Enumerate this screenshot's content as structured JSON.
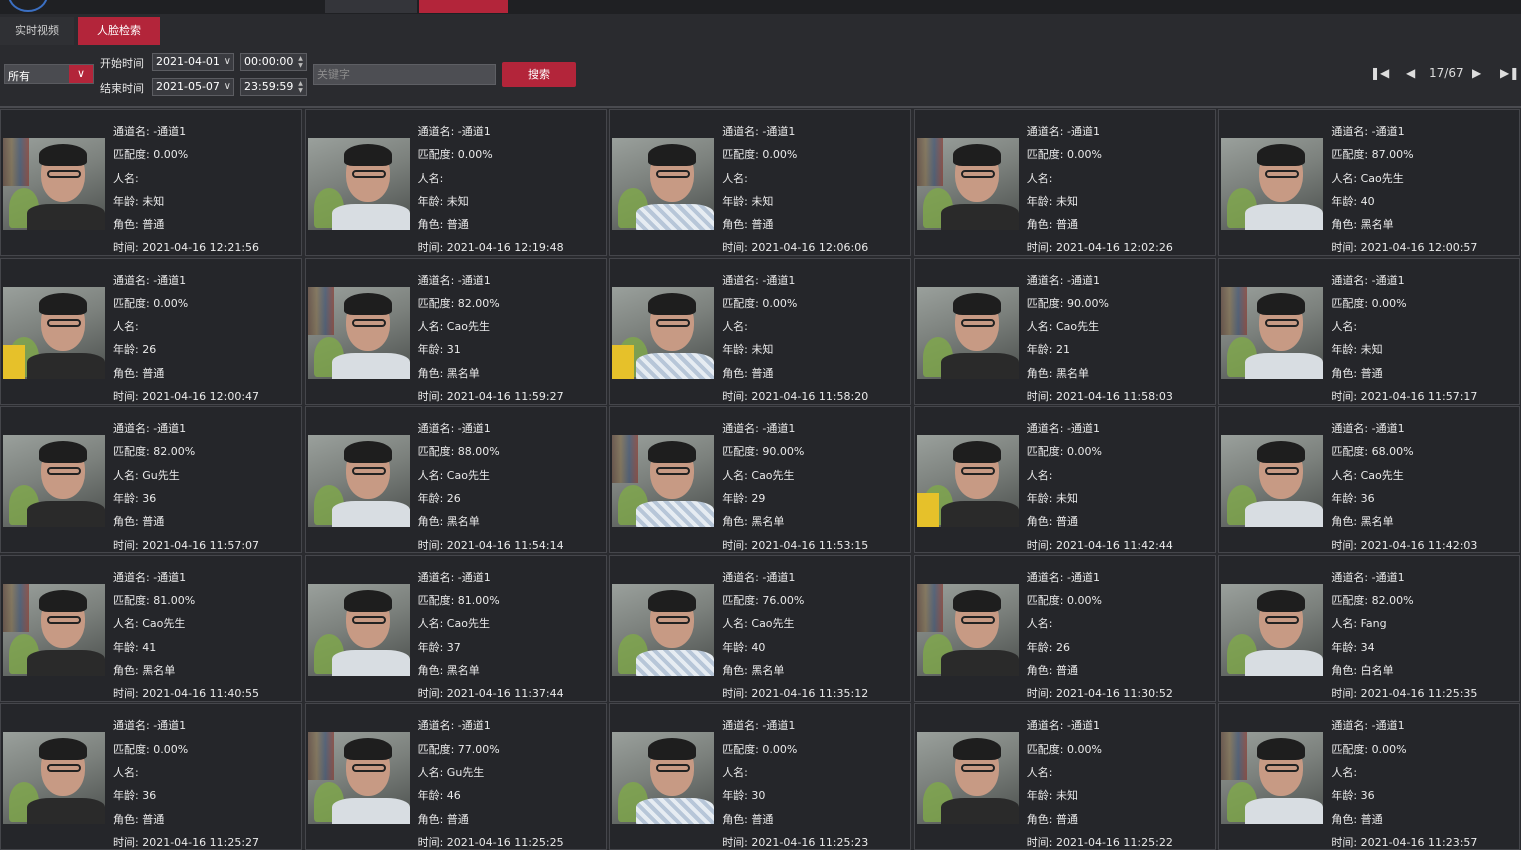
{
  "top_tabs": [
    "",
    ""
  ],
  "sub_tabs": [
    "实时视频",
    "人脸检索"
  ],
  "filter": {
    "select_value": "所有",
    "start_label": "开始时间",
    "end_label": "结束时间",
    "start_date": "2021-04-01",
    "start_time": "00:00:00",
    "end_date": "2021-05-07",
    "end_time": "23:59:59",
    "keyword_placeholder": "关键字",
    "search_label": "搜索"
  },
  "pager": {
    "page": "17/67"
  },
  "field_labels": {
    "channel": "通道名: ",
    "match": "匹配度: ",
    "name": "人名: ",
    "age": "年龄: ",
    "role": "角色: ",
    "time": "时间: "
  },
  "cards": [
    {
      "channel": "-通道1",
      "match": "0.00%",
      "name": "",
      "age": "未知",
      "role": "普通",
      "time": "2021-04-16 12:21:56"
    },
    {
      "channel": "-通道1",
      "match": "0.00%",
      "name": "",
      "age": "未知",
      "role": "普通",
      "time": "2021-04-16 12:19:48"
    },
    {
      "channel": "-通道1",
      "match": "0.00%",
      "name": "",
      "age": "未知",
      "role": "普通",
      "time": "2021-04-16 12:06:06"
    },
    {
      "channel": "-通道1",
      "match": "0.00%",
      "name": "",
      "age": "未知",
      "role": "普通",
      "time": "2021-04-16 12:02:26"
    },
    {
      "channel": "-通道1",
      "match": "87.00%",
      "name": "Cao先生",
      "age": "40",
      "role": "黑名单",
      "time": "2021-04-16 12:00:57"
    },
    {
      "channel": "-通道1",
      "match": "0.00%",
      "name": "",
      "age": "26",
      "role": "普通",
      "time": "2021-04-16 12:00:47"
    },
    {
      "channel": "-通道1",
      "match": "82.00%",
      "name": "Cao先生",
      "age": "31",
      "role": "黑名单",
      "time": "2021-04-16 11:59:27"
    },
    {
      "channel": "-通道1",
      "match": "0.00%",
      "name": "",
      "age": "未知",
      "role": "普通",
      "time": "2021-04-16 11:58:20"
    },
    {
      "channel": "-通道1",
      "match": "90.00%",
      "name": "Cao先生",
      "age": "21",
      "role": "黑名单",
      "time": "2021-04-16 11:58:03"
    },
    {
      "channel": "-通道1",
      "match": "0.00%",
      "name": "",
      "age": "未知",
      "role": "普通",
      "time": "2021-04-16 11:57:17"
    },
    {
      "channel": "-通道1",
      "match": "82.00%",
      "name": "Gu先生",
      "age": "36",
      "role": "普通",
      "time": "2021-04-16 11:57:07"
    },
    {
      "channel": "-通道1",
      "match": "88.00%",
      "name": "Cao先生",
      "age": "26",
      "role": "黑名单",
      "time": "2021-04-16 11:54:14"
    },
    {
      "channel": "-通道1",
      "match": "90.00%",
      "name": "Cao先生",
      "age": "29",
      "role": "黑名单",
      "time": "2021-04-16 11:53:15"
    },
    {
      "channel": "-通道1",
      "match": "0.00%",
      "name": "",
      "age": "未知",
      "role": "普通",
      "time": "2021-04-16 11:42:44"
    },
    {
      "channel": "-通道1",
      "match": "68.00%",
      "name": "Cao先生",
      "age": "36",
      "role": "黑名单",
      "time": "2021-04-16 11:42:03"
    },
    {
      "channel": "-通道1",
      "match": "81.00%",
      "name": "Cao先生",
      "age": "41",
      "role": "黑名单",
      "time": "2021-04-16 11:40:55"
    },
    {
      "channel": "-通道1",
      "match": "81.00%",
      "name": "Cao先生",
      "age": "37",
      "role": "黑名单",
      "time": "2021-04-16 11:37:44"
    },
    {
      "channel": "-通道1",
      "match": "76.00%",
      "name": "Cao先生",
      "age": "40",
      "role": "黑名单",
      "time": "2021-04-16 11:35:12"
    },
    {
      "channel": "-通道1",
      "match": "0.00%",
      "name": "",
      "age": "26",
      "role": "普通",
      "time": "2021-04-16 11:30:52"
    },
    {
      "channel": "-通道1",
      "match": "82.00%",
      "name": "Fang",
      "age": "34",
      "role": "白名单",
      "time": "2021-04-16 11:25:35"
    },
    {
      "channel": "-通道1",
      "match": "0.00%",
      "name": "",
      "age": "36",
      "role": "普通",
      "time": "2021-04-16 11:25:27"
    },
    {
      "channel": "-通道1",
      "match": "77.00%",
      "name": "Gu先生",
      "age": "46",
      "role": "普通",
      "time": "2021-04-16 11:25:25"
    },
    {
      "channel": "-通道1",
      "match": "0.00%",
      "name": "",
      "age": "30",
      "role": "普通",
      "time": "2021-04-16 11:25:23"
    },
    {
      "channel": "-通道1",
      "match": "0.00%",
      "name": "",
      "age": "未知",
      "role": "普通",
      "time": "2021-04-16 11:25:22"
    },
    {
      "channel": "-通道1",
      "match": "0.00%",
      "name": "",
      "age": "36",
      "role": "普通",
      "time": "2021-04-16 11:23:57"
    }
  ]
}
